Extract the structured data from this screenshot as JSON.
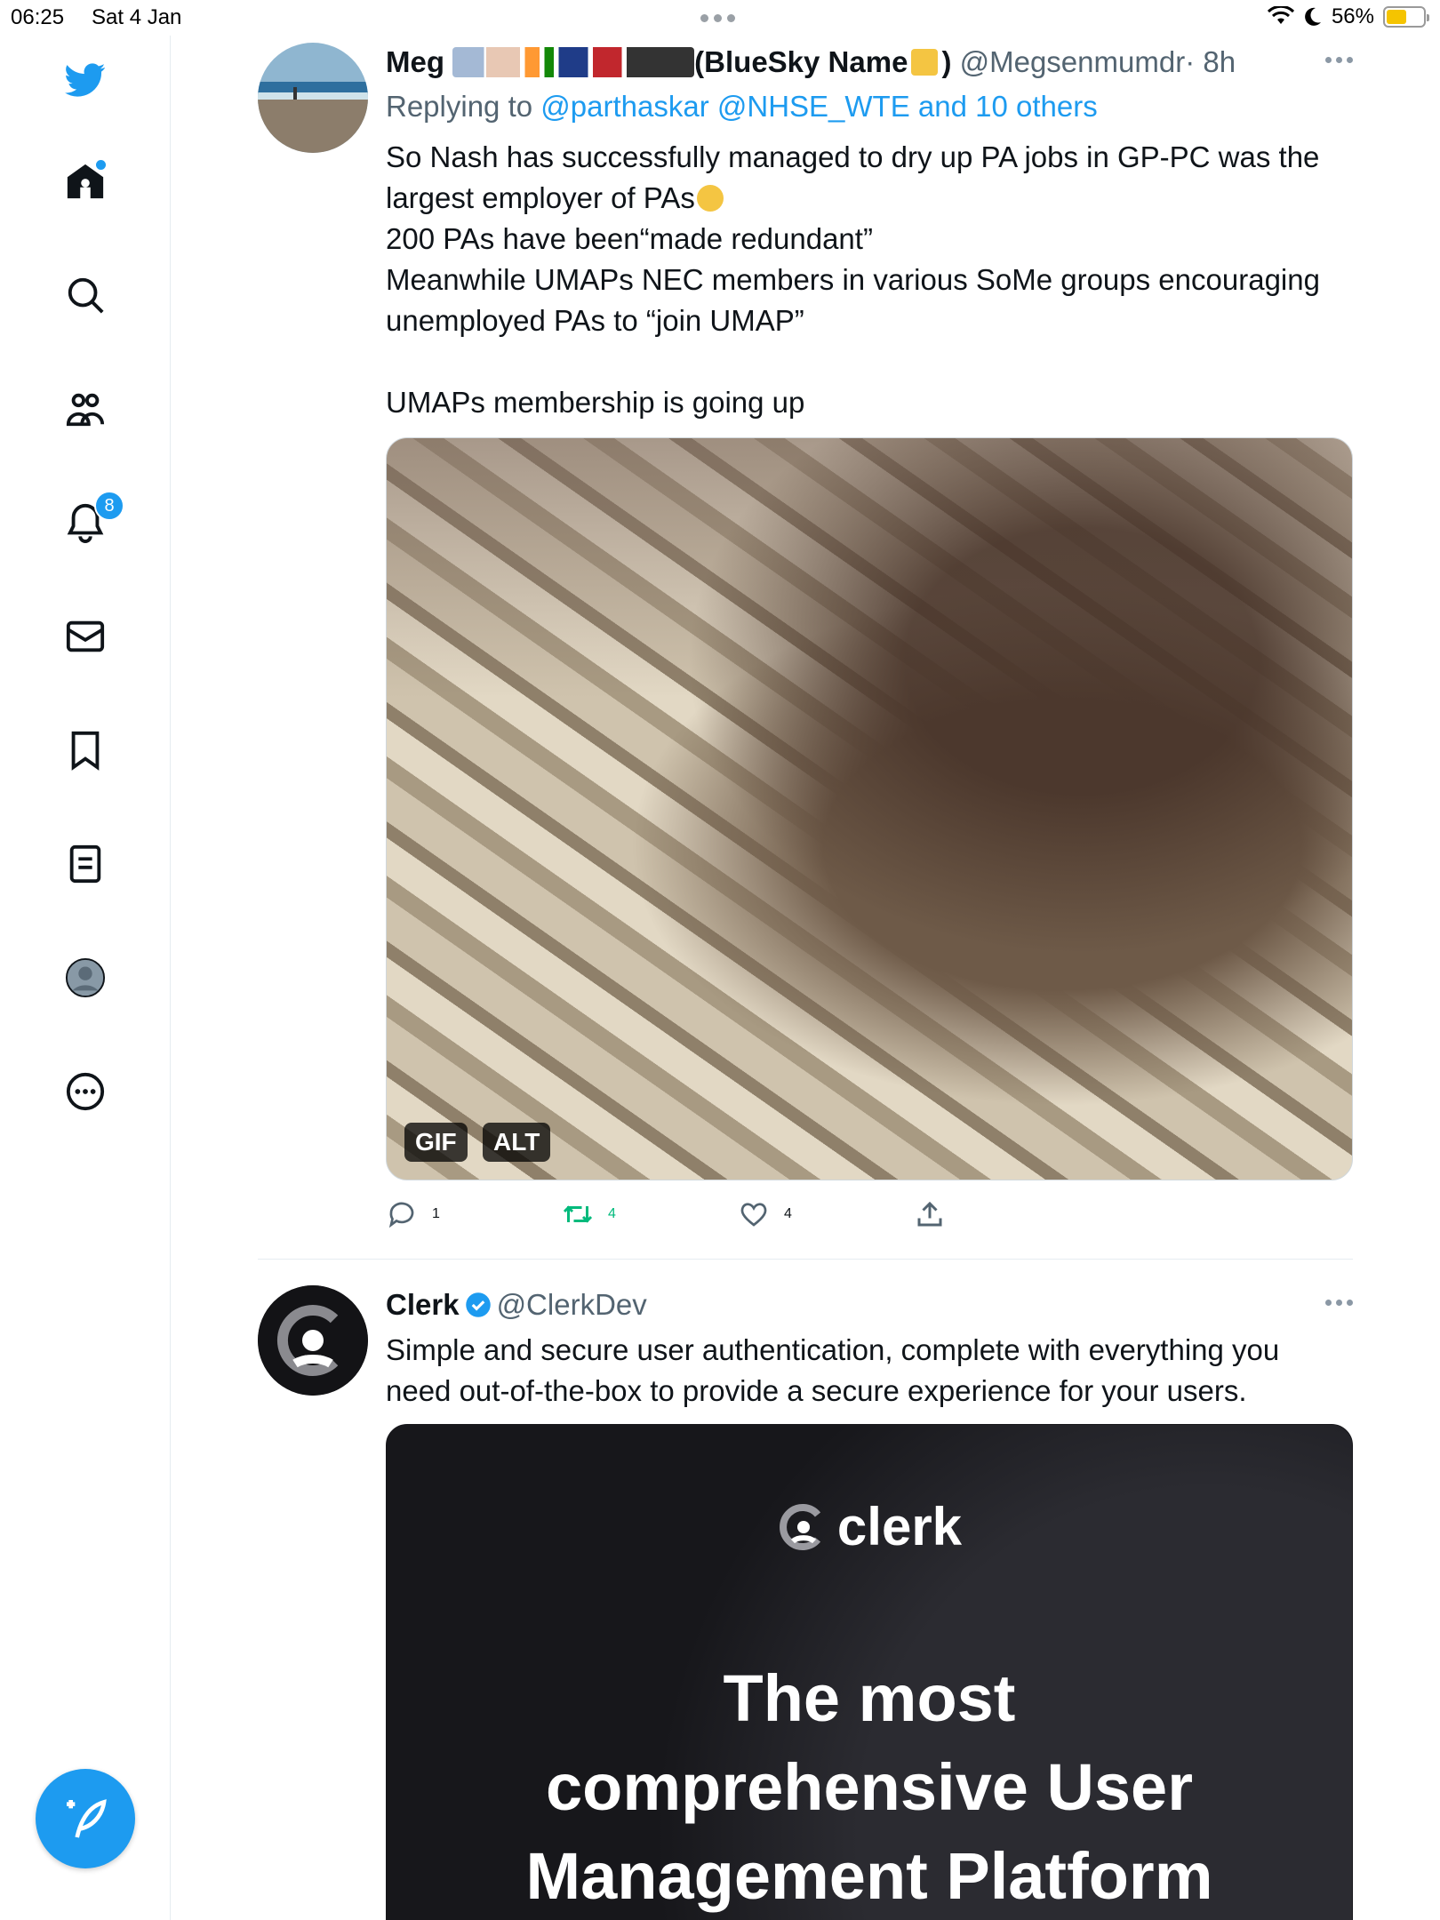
{
  "status_bar": {
    "time": "06:25",
    "date": "Sat 4 Jan",
    "battery": "56%",
    "battery_level": 0.56
  },
  "sidebar": {
    "items": [
      {
        "icon": "twitter-bird-icon"
      },
      {
        "icon": "home-icon"
      },
      {
        "icon": "search-icon"
      },
      {
        "icon": "communities-icon"
      },
      {
        "icon": "notifications-icon",
        "badge": "8"
      },
      {
        "icon": "messages-icon"
      },
      {
        "icon": "bookmarks-icon"
      },
      {
        "icon": "lists-icon"
      },
      {
        "icon": "profile-icon"
      },
      {
        "icon": "more-icon"
      }
    ],
    "compose_icon": "compose-icon"
  },
  "tweets": [
    {
      "name": "Meg",
      "name_suffix": "(BlueSky Name",
      "name_end": ")",
      "handle": "@Megsenmumdr",
      "time": "· 8h",
      "replying_prefix": "Replying to",
      "replying_links": "@parthaskar @NHSE_WTE and 10 others",
      "lines": [
        "So Nash has successfully managed to dry up PA jobs in GP-PC was the",
        "largest employer of PAs",
        "200 PAs have been“made redundant”",
        "Meanwhile UMAPs NEC members in various SoMe groups encouraging",
        "unemployed PAs to “join UMAP”",
        "",
        "UMAPs membership is going up"
      ],
      "media_badges": {
        "gif": "GIF",
        "alt": "ALT"
      },
      "counts": {
        "replies": "1",
        "retweets": "4",
        "likes": "4"
      }
    },
    {
      "name": "Clerk",
      "handle": "@ClerkDev",
      "lines": [
        "Simple and secure user authentication, complete with everything you",
        "need out-of-the-box to provide a secure experience for your users."
      ],
      "ad_logo_text": "clerk",
      "ad_headline": [
        "The most",
        "comprehensive User",
        "Management Platform"
      ]
    }
  ],
  "colors": {
    "accent": "#1d9bf0",
    "retweet": "#00ba7c",
    "text": "#0f1419",
    "muted": "#536471"
  }
}
